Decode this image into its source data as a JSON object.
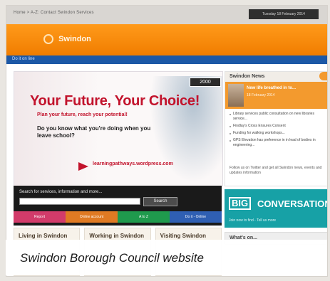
{
  "caption": "Swindon Borough Council website",
  "header": {
    "breadcrumb": "Home > A-Z: Contact Swindon Services",
    "date_pill": "Tuesday 18 February 2014",
    "logo_text": "Swindon",
    "nav_text": "Do it on line"
  },
  "hero": {
    "badge": "2000",
    "title": "Your Future, Your Choice!",
    "subtitle": "Plan your future, reach your potential!",
    "question": "Do you know what you're doing when you leave school?",
    "url": "learningpathways.wordpress.com"
  },
  "search": {
    "label": "Search for services, information and more...",
    "input_placeholder": "",
    "button": "Search",
    "quicklinks": [
      {
        "label": "Report",
        "color": "#d23b6a"
      },
      {
        "label": "Online account",
        "color": "#e07a23"
      },
      {
        "label": "A to Z",
        "color": "#1f9a4d"
      },
      {
        "label": "Do it - Online",
        "color": "#2f5fb3"
      }
    ]
  },
  "columns": [
    {
      "heading": "Living in Swindon"
    },
    {
      "heading": "Working in Swindon"
    },
    {
      "heading": "Visiting Swindon"
    }
  ],
  "sidebar": {
    "title": "Swindon News",
    "feature_headline": "New life breathed in to...",
    "feature_date": "18 February 2014",
    "news_items": [
      "Library services public consultation on new libraries service...",
      "Findlay's Cross Ensures Consent",
      "Funding for walking workshops...",
      "GPS Elevation has preference in in lead of bodies in engineering...",
      "Follow us on Twitter and get the latest"
    ],
    "follow_text": "Follow us on Twitter and get all Swindon news, events and updates information"
  },
  "big_conversation": {
    "box": "BIG",
    "text": "CONVERSATION",
    "sub": "Join now to find - Tell us more"
  },
  "whats_on": {
    "title": "What's on..."
  }
}
